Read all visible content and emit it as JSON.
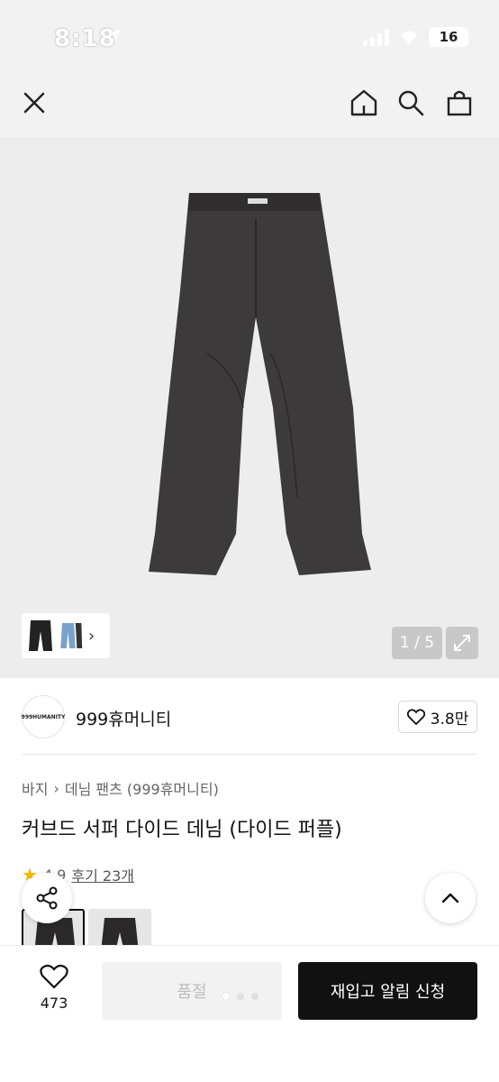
{
  "status_bar": {
    "time": "8:18",
    "battery": "16"
  },
  "nav": {
    "close_icon": "close-icon",
    "home_icon": "home-icon",
    "search_icon": "search-icon",
    "cart_icon": "shopping-bag-icon"
  },
  "gallery": {
    "page_counter": "1 / 5"
  },
  "brand": {
    "logo_text": "999HUMANITY",
    "name": "999휴머니티",
    "likes": "3.8만"
  },
  "breadcrumb": {
    "level1": "바지",
    "level2": "데님 팬츠 (999휴머니티)"
  },
  "product": {
    "title": "커브드 서퍼 다이드 데님 (다이드 퍼플)",
    "rating": "4.9",
    "reviews": "후기 23개"
  },
  "bottom": {
    "wish_count": "473",
    "soldout_label": "품절",
    "restock_label": "재입고 알림 신청"
  },
  "colors": {
    "accent": "#111111",
    "star": "#f6b800",
    "image_bg": "#ededed"
  }
}
